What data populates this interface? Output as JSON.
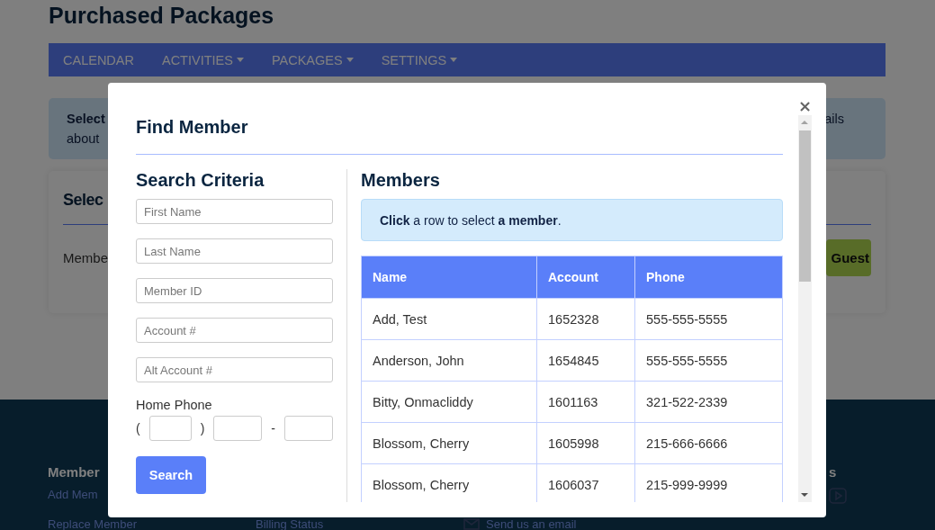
{
  "page": {
    "title": "Purchased Packages",
    "nav": [
      {
        "label": "CALENDAR",
        "dropdown": false
      },
      {
        "label": "ACTIVITIES",
        "dropdown": true
      },
      {
        "label": "PACKAGES",
        "dropdown": true
      },
      {
        "label": "SETTINGS",
        "dropdown": true
      }
    ],
    "notice": {
      "line_1": "Select",
      "line_2": "about",
      "right_text": "ails"
    },
    "card": {
      "heading": "Selec",
      "label": "Membe",
      "button": "Guest"
    },
    "footer": {
      "heading": "Member",
      "links": [
        "Add Mem",
        "Replace Member"
      ],
      "column_2": "Billing Status",
      "email": "Send us an email",
      "right_text": "s"
    }
  },
  "modal": {
    "title": "Find Member",
    "close": "×",
    "search": {
      "heading": "Search Criteria",
      "fields": [
        {
          "placeholder": "First Name"
        },
        {
          "placeholder": "Last Name"
        },
        {
          "placeholder": "Member ID"
        },
        {
          "placeholder": "Account #"
        },
        {
          "placeholder": "Alt Account #"
        }
      ],
      "phone_label": "Home Phone",
      "phone_symbols": [
        "(",
        ")",
        "-"
      ],
      "button": "Search"
    },
    "members": {
      "heading": "Members",
      "hint": "**Click** a row to select **a member**.",
      "columns": [
        "Name",
        "Account",
        "Phone"
      ],
      "rows": [
        [
          "Add, Test",
          "1652328",
          "555-555-5555"
        ],
        [
          "Anderson, John",
          "1654845",
          "555-555-5555"
        ],
        [
          "Bitty, Onmacliddy",
          "1601163",
          "321-522-2339"
        ],
        [
          "Blossom, Cherry",
          "1605998",
          "215-666-6666"
        ],
        [
          "Blossom, Cherry",
          "1606037",
          "215-999-9999"
        ]
      ]
    }
  }
}
